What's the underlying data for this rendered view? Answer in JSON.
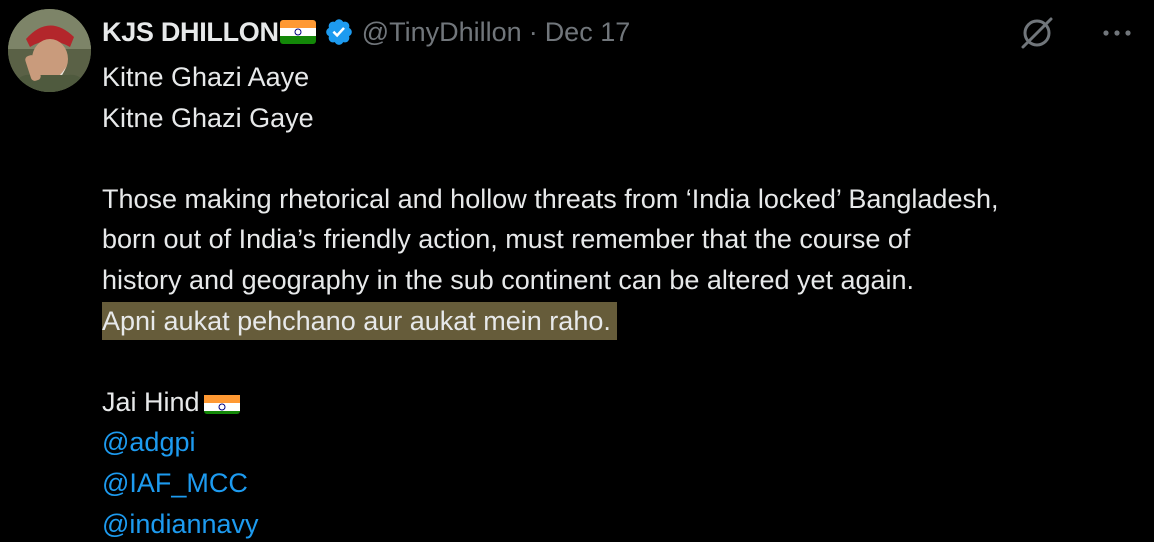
{
  "author": {
    "display_name": "KJS DHILLON",
    "name_flag_icon": "india-flag-icon",
    "verified_icon": "verified-badge-icon",
    "handle": "@TinyDhillon",
    "separator": "·",
    "date": "Dec 17",
    "avatar_icon": "profile-avatar"
  },
  "actions": {
    "grok_icon": "grok-icon",
    "more_icon": "more-options-icon"
  },
  "post": {
    "line1": "Kitne Ghazi Aaye",
    "line2": "Kitne Ghazi Gaye",
    "line3": "Those making rhetorical and hollow threats from ‘India locked’ Bangladesh,",
    "line4": "born out of India’s friendly action, must remember that the course of",
    "line5": "history and geography in the sub continent can be altered yet again.",
    "highlighted_line": "Apni aukat pehchano aur aukat mein raho.",
    "sign_off": "Jai Hind",
    "sign_off_flag_icon": "india-flag-icon",
    "mentions": [
      "@adgpi",
      "@IAF_MCC",
      "@indiannavy"
    ]
  },
  "colors": {
    "background": "#000000",
    "text": "#e7e9ea",
    "secondary_text": "#71767b",
    "link": "#1d9bf0",
    "highlight": "#665c3a",
    "verified": "#1d9bf0"
  }
}
